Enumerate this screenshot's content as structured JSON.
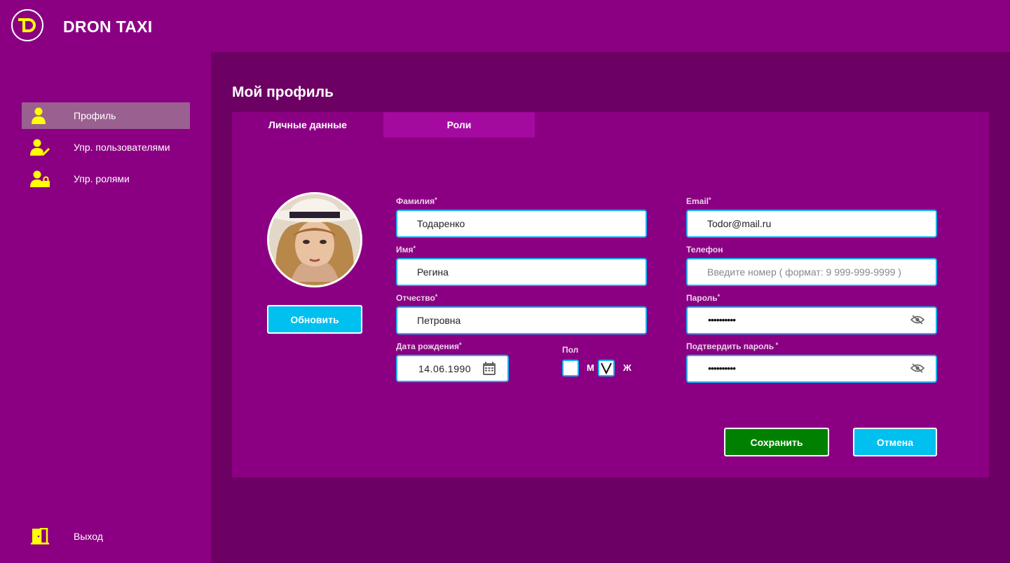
{
  "app": {
    "brand": "DRON TAXI",
    "logo_letter": "D"
  },
  "sidebar": {
    "items": [
      {
        "label": "Профиль",
        "icon": "user-icon",
        "active": true
      },
      {
        "label": "Упр. пользователями",
        "icon": "user-edit-icon"
      },
      {
        "label": "Упр. ролями",
        "icon": "user-lock-icon"
      }
    ],
    "logout": {
      "label": "Выход",
      "icon": "exit-door-icon"
    }
  },
  "page": {
    "title": "Мой профиль"
  },
  "tabs": [
    {
      "label": "Личные данные",
      "active": true
    },
    {
      "label": "Роли"
    }
  ],
  "profile": {
    "update_label": "Обновить",
    "fields": {
      "last_name": {
        "label": "Фамилия",
        "req": "*",
        "value": "Тодаренко"
      },
      "first_name": {
        "label": "Имя",
        "req": "*",
        "value": "Регина"
      },
      "middle_name": {
        "label": "Отчество",
        "req": "*",
        "value": "Петровна"
      },
      "birth_date": {
        "label": "Дата рождения",
        "req": "*",
        "value": "14.06.1990"
      },
      "gender": {
        "label": "Пол",
        "male": "М",
        "female": "Ж",
        "selected": "female"
      },
      "email": {
        "label": "Email",
        "req": "*",
        "value": "Todor@mail.ru"
      },
      "phone": {
        "label": "Телефон",
        "placeholder": "Введите номер ( формат: 9 999-999-9999 )"
      },
      "password": {
        "label": "Пароль",
        "req": "*",
        "value": "••••••••••"
      },
      "confirm_password": {
        "label": "Подтвердить пароль",
        "req": " *",
        "value": "••••••••••"
      }
    },
    "save_label": "Сохранить",
    "cancel_label": "Отмена"
  },
  "colors": {
    "primary": "#8b0083",
    "main_bg": "#6c0063",
    "accent_yellow": "#ffff00",
    "button_blue": "#00c0f0",
    "button_green": "#008000",
    "input_border": "#18b4f0"
  }
}
